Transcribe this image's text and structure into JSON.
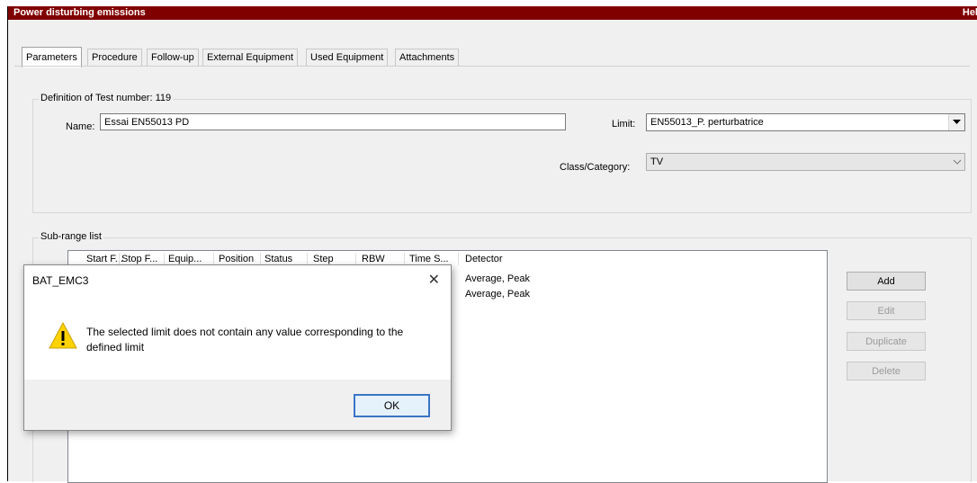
{
  "window": {
    "title": "Power disturbing emissions",
    "help_label": "Hel"
  },
  "tabs": [
    {
      "label": "Parameters",
      "active": true
    },
    {
      "label": "Procedure"
    },
    {
      "label": "Follow-up"
    },
    {
      "label": "External Equipment"
    },
    {
      "label": "Used Equipment"
    },
    {
      "label": "Attachments"
    }
  ],
  "definition": {
    "legend": "Definition of Test number: 119",
    "name_label": "Name:",
    "name_value": "Essai EN55013 PD",
    "limit_label": "Limit:",
    "limit_value": "EN55013_P. perturbatrice",
    "class_label": "Class/Category:",
    "class_value": "TV"
  },
  "subrange": {
    "legend": "Sub-range list",
    "columns": [
      "Start F...",
      "Stop F...",
      "Equip...",
      "Position",
      "Status",
      "Step",
      "RBW",
      "Time S...",
      "Detector"
    ],
    "rows": [
      {
        "detector": "Average, Peak"
      },
      {
        "detector": "Average, Peak"
      }
    ]
  },
  "side_buttons": {
    "add": "Add",
    "edit": "Edit",
    "duplicate": "Duplicate",
    "delete": "Delete"
  },
  "dialog": {
    "title": "BAT_EMC3",
    "close": "✕",
    "message": "The selected limit does not contain any value corresponding to the defined limit",
    "ok": "OK"
  },
  "colors": {
    "titlebar": "#800000",
    "dialog_ok_border": "#3a74c7",
    "warning_fill": "#ffd200"
  }
}
